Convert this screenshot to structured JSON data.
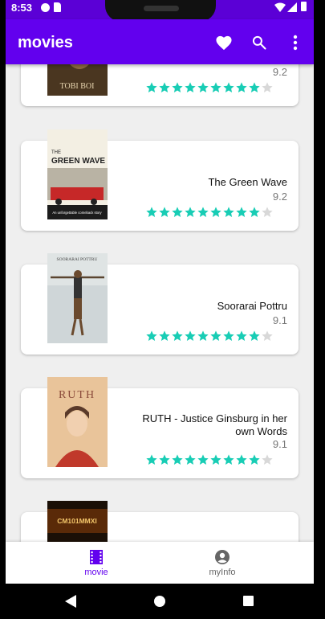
{
  "status_bar": {
    "time": "8:53"
  },
  "app_bar": {
    "title": "movies",
    "icons": [
      "heart-icon",
      "search-icon",
      "more-vert-icon"
    ]
  },
  "movies": [
    {
      "title": "",
      "rating": "9.2",
      "stars": 9,
      "poster_icon": "poster-thumbnail",
      "poster_text": "TOBI BOI"
    },
    {
      "title": "The Green Wave",
      "rating": "9.2",
      "stars": 9,
      "poster_icon": "poster-thumbnail",
      "poster_text": "THE GREEN WAVE",
      "poster_tagline": "An unforgettable comeback story"
    },
    {
      "title": "Soorarai Pottru",
      "rating": "9.1",
      "stars": 9,
      "poster_icon": "poster-thumbnail",
      "poster_text": "SOORARAI POTTRU"
    },
    {
      "title": "RUTH - Justice Ginsburg in her own Words",
      "rating": "9.1",
      "stars": 9,
      "poster_icon": "poster-thumbnail",
      "poster_text": "RUTH"
    },
    {
      "title": "",
      "rating": "",
      "stars": 0,
      "poster_icon": "poster-thumbnail",
      "poster_text": "CM101MMXI"
    }
  ],
  "bottom_nav": {
    "items": [
      {
        "label": "movie",
        "icon": "film-icon",
        "active": true
      },
      {
        "label": "myInfo",
        "icon": "account-circle-icon",
        "active": false
      }
    ]
  },
  "colors": {
    "primary": "#6200ee",
    "status_bar": "#5b00d6",
    "star_filled": "#18cdb5",
    "star_empty": "#d8d8d8"
  }
}
